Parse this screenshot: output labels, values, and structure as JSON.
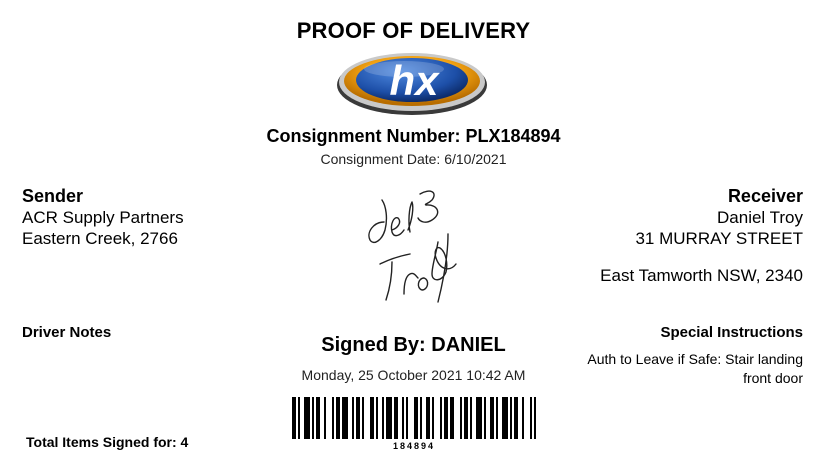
{
  "document": {
    "title": "PROOF OF DELIVERY",
    "logo_text": "hx",
    "consignment_number": "Consignment Number: PLX184894",
    "consignment_date": "Consignment Date: 6/10/2021"
  },
  "sender": {
    "heading": "Sender",
    "name": "ACR Supply Partners",
    "location": "Eastern Creek, 2766"
  },
  "receiver": {
    "heading": "Receiver",
    "name": "Daniel Troy",
    "street": "31 MURRAY STREET",
    "location": "East Tamworth NSW, 2340"
  },
  "signature": {
    "handwritten_text": "del3 Troy",
    "signed_by": "Signed By: DANIEL",
    "signed_time": "Monday, 25 October 2021 10:42 AM"
  },
  "driver_notes": {
    "heading": "Driver Notes"
  },
  "special_instructions": {
    "heading": "Special Instructions",
    "text": "Auth to Leave if Safe: Stair landing front door"
  },
  "barcode": {
    "number": "184894"
  },
  "totals": {
    "items_signed": "Total Items Signed for: 4"
  },
  "colors": {
    "logo_blue": "#1d4fa8",
    "logo_orange": "#f0a012",
    "text": "#000000"
  }
}
